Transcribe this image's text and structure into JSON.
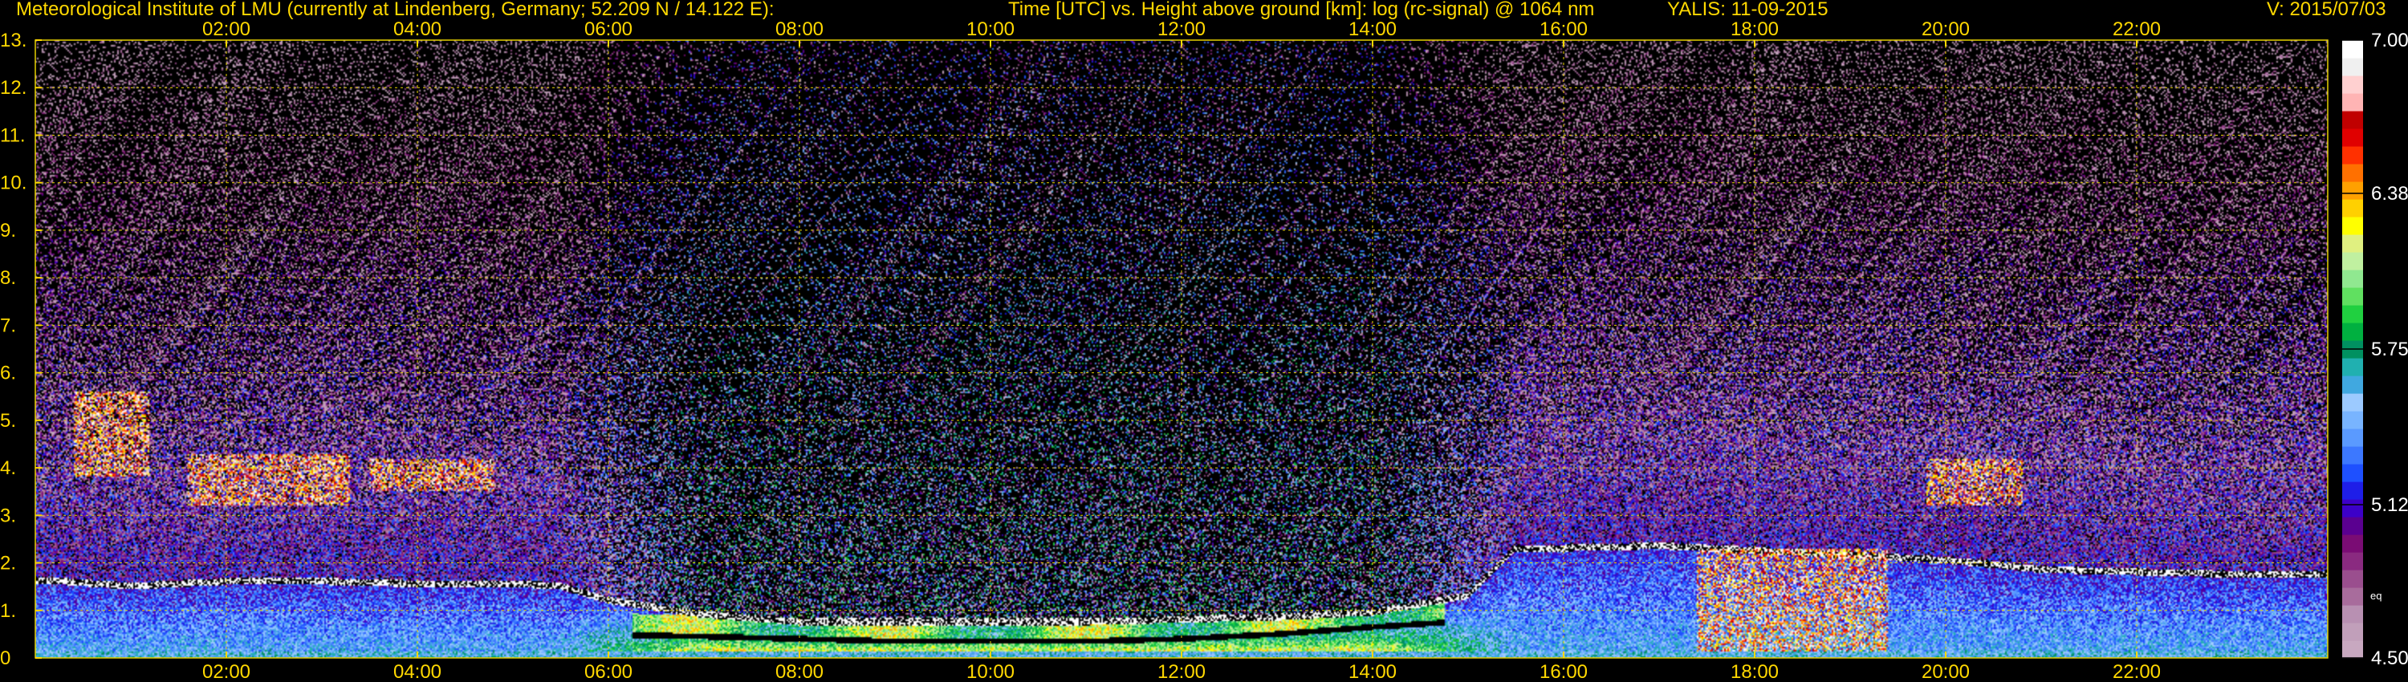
{
  "header": {
    "institute": "Meteorological Institute of LMU (currently at Lindenberg, Germany; 52.209 N / 14.122 E):",
    "plot_title": "Time [UTC] vs. Height above ground [km]: log (rc-signal) @ 1064 nm",
    "instrument_date": "YALIS: 11-09-2015",
    "version": "V: 2015/07/03"
  },
  "colors": {
    "text": "#ffd800",
    "grid": "#e5d000",
    "background": "#000000"
  },
  "chart_data": {
    "type": "heatmap",
    "x_unit": "hours UTC",
    "xlim": [
      0,
      24
    ],
    "ylim": [
      0,
      13
    ],
    "x_ticks": [
      2,
      4,
      6,
      8,
      10,
      12,
      14,
      16,
      18,
      20,
      22
    ],
    "x_tick_labels": [
      "02:00",
      "04:00",
      "06:00",
      "08:00",
      "10:00",
      "12:00",
      "14:00",
      "16:00",
      "18:00",
      "20:00",
      "22:00"
    ],
    "y_ticks": [
      0,
      1,
      2,
      3,
      4,
      5,
      6,
      7,
      8,
      9,
      10,
      11,
      12,
      13
    ],
    "y_tick_labels": [
      "0",
      "1.",
      "2.",
      "3.",
      "4.",
      "5.",
      "6.",
      "7.",
      "8.",
      "9.",
      "10.",
      "11.",
      "12.",
      "13."
    ],
    "grid": true,
    "colorbar": {
      "min": 4.5,
      "max": 7.0,
      "tick_values": [
        7.0,
        6.38,
        5.75,
        5.12,
        4.5
      ],
      "tick_labels": [
        "7.00",
        "6.38",
        "5.75",
        "5.12",
        "4.50"
      ],
      "small_label": "eq",
      "colors": [
        "#c8a8c0",
        "#c19fba",
        "#b890b2",
        "#a86c9c",
        "#9a4e8e",
        "#8a2a80",
        "#7a0c74",
        "#5a0090",
        "#3c00c8",
        "#1e1ee8",
        "#1e50ff",
        "#3c78ff",
        "#5a9aff",
        "#78b4ff",
        "#9ccaff",
        "#40a8e0",
        "#20b0b0",
        "#009060",
        "#00b040",
        "#20d040",
        "#60e060",
        "#90e890",
        "#c0f0a0",
        "#e0f080",
        "#ffff00",
        "#ffd000",
        "#ffa000",
        "#ff7000",
        "#ff3000",
        "#e00000",
        "#c00000",
        "#ffb4b4",
        "#ffd0d0",
        "#f0f0f0",
        "#ffffff"
      ]
    },
    "features": {
      "boundary_layer_top_km": [
        [
          0.3,
          1.6
        ],
        [
          1,
          1.5
        ],
        [
          1.5,
          1.55
        ],
        [
          2,
          1.6
        ],
        [
          3,
          1.6
        ],
        [
          4,
          1.55
        ],
        [
          5,
          1.55
        ],
        [
          5.5,
          1.5
        ],
        [
          6,
          1.2
        ],
        [
          7,
          0.9
        ],
        [
          8,
          0.75
        ],
        [
          9,
          0.75
        ],
        [
          10,
          0.75
        ],
        [
          11,
          0.75
        ],
        [
          12,
          0.8
        ],
        [
          13,
          0.85
        ],
        [
          14,
          0.95
        ],
        [
          15,
          1.3
        ],
        [
          15.5,
          2.3
        ],
        [
          16,
          2.3
        ],
        [
          17,
          2.35
        ],
        [
          18,
          2.25
        ],
        [
          19,
          2.15
        ],
        [
          20,
          2.05
        ],
        [
          21,
          1.85
        ],
        [
          22,
          1.8
        ],
        [
          23,
          1.75
        ],
        [
          24,
          1.75
        ]
      ],
      "aerosol_layer_base_km": [
        [
          5.8,
          0.5
        ],
        [
          7,
          0.45
        ],
        [
          8,
          0.4
        ],
        [
          9,
          0.35
        ],
        [
          10,
          0.35
        ],
        [
          11,
          0.35
        ],
        [
          12,
          0.4
        ],
        [
          13,
          0.5
        ],
        [
          14,
          0.65
        ],
        [
          14.8,
          0.75
        ]
      ],
      "cloud_patches": [
        {
          "t": [
            0.4,
            1.2
          ],
          "z": [
            3.8,
            5.6
          ]
        },
        {
          "t": [
            1.6,
            3.3
          ],
          "z": [
            3.2,
            4.3
          ]
        },
        {
          "t": [
            3.5,
            4.8
          ],
          "z": [
            3.5,
            4.2
          ]
        },
        {
          "t": [
            17.4,
            19.4
          ],
          "z": [
            0.1,
            2.3
          ]
        },
        {
          "t": [
            19.8,
            20.8
          ],
          "z": [
            3.2,
            4.2
          ]
        }
      ]
    }
  }
}
